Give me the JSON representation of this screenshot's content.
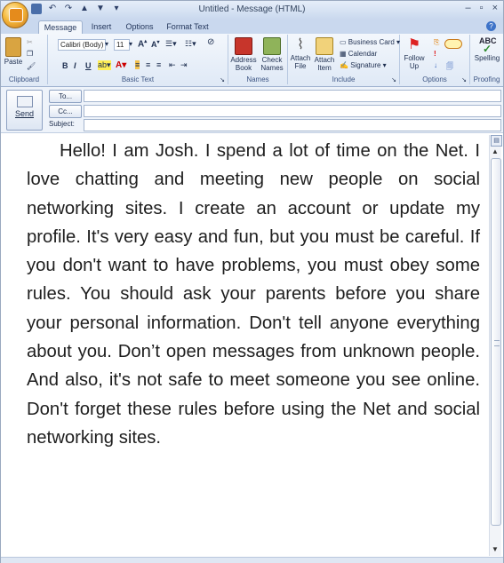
{
  "window": {
    "title": "Untitled - Message (HTML)"
  },
  "tabs": [
    {
      "label": "Message",
      "active": true
    },
    {
      "label": "Insert",
      "active": false
    },
    {
      "label": "Options",
      "active": false
    },
    {
      "label": "Format Text",
      "active": false
    }
  ],
  "ribbon": {
    "clipboard": {
      "group_label": "Clipboard",
      "paste_label": "Paste"
    },
    "basic_text": {
      "group_label": "Basic Text",
      "font_name": "Calibri (Body)",
      "font_size": "11",
      "bold": "B",
      "italic": "I",
      "underline": "U"
    },
    "names": {
      "group_label": "Names",
      "address_book_label": "Address Book",
      "check_names_label": "Check Names"
    },
    "include": {
      "group_label": "Include",
      "attach_file_label": "Attach File",
      "attach_item_label": "Attach Item",
      "business_card_label": "Business Card",
      "calendar_label": "Calendar",
      "signature_label": "Signature"
    },
    "options": {
      "group_label": "Options",
      "follow_up_label": "Follow Up"
    },
    "proofing": {
      "group_label": "Proofing",
      "spelling_label": "Spelling",
      "abc_label": "ABC"
    }
  },
  "address": {
    "send_label": "Send",
    "to_label": "To...",
    "cc_label": "Cc...",
    "subject_label": "Subject:"
  },
  "message_body": "Hello! I am Josh. I spend a lot of time on the Net. I love chatting and meeting new people on social networking sites. I create an account or update my profile. It's very easy and fun, but you must be careful. If you don't want to have problems, you must obey some rules. You should ask your parents before you share your personal information. Don't tell anyone everything about you. Don’t open messages from unknown people. And also, it's not safe to meet someone you see online. Don't forget these rules before using the Net and social networking sites."
}
